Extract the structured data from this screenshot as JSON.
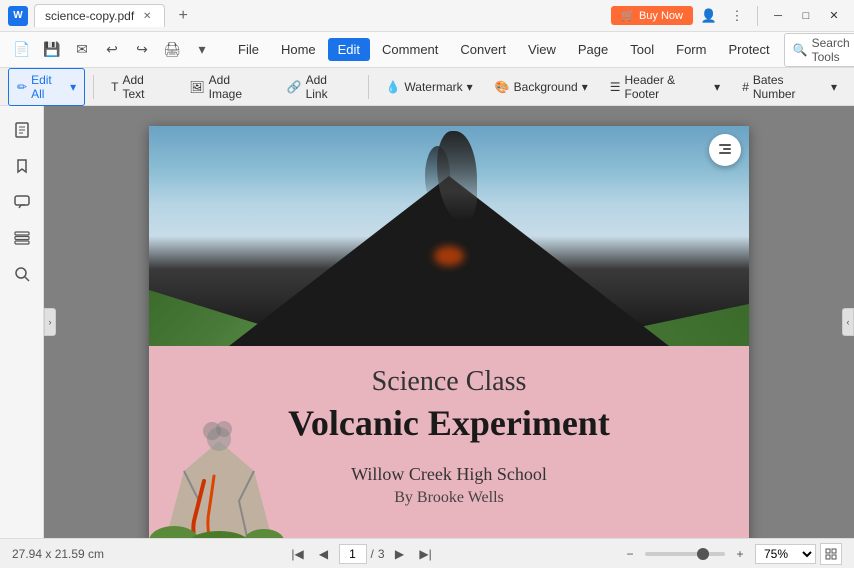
{
  "titlebar": {
    "filename": "science-copy.pdf",
    "app_icon_label": "W",
    "buy_now_label": "Buy Now"
  },
  "menubar": {
    "file": "File",
    "home": "Home",
    "edit": "Edit",
    "comment": "Comment",
    "convert": "Convert",
    "view": "View",
    "page": "Page",
    "tool": "Tool",
    "form": "Form",
    "protect": "Protect",
    "search_tools": "Search Tools"
  },
  "toolbar": {
    "edit_all": "Edit All",
    "add_text": "Add Text",
    "add_image": "Add Image",
    "add_link": "Add Link",
    "watermark": "Watermark",
    "background": "Background",
    "header_footer": "Header & Footer",
    "bates_number": "Bates Number",
    "dropdown_arrow": "▾"
  },
  "pdf": {
    "title_small": "Science Class",
    "title_large": "Volcanic Experiment",
    "subtitle": "Willow Creek High School",
    "author": "By Brooke Wells"
  },
  "statusbar": {
    "dimensions": "27.94 x 21.59 cm",
    "current_page": "1",
    "total_pages": "3",
    "page_sep": "/",
    "zoom_level": "75%"
  }
}
